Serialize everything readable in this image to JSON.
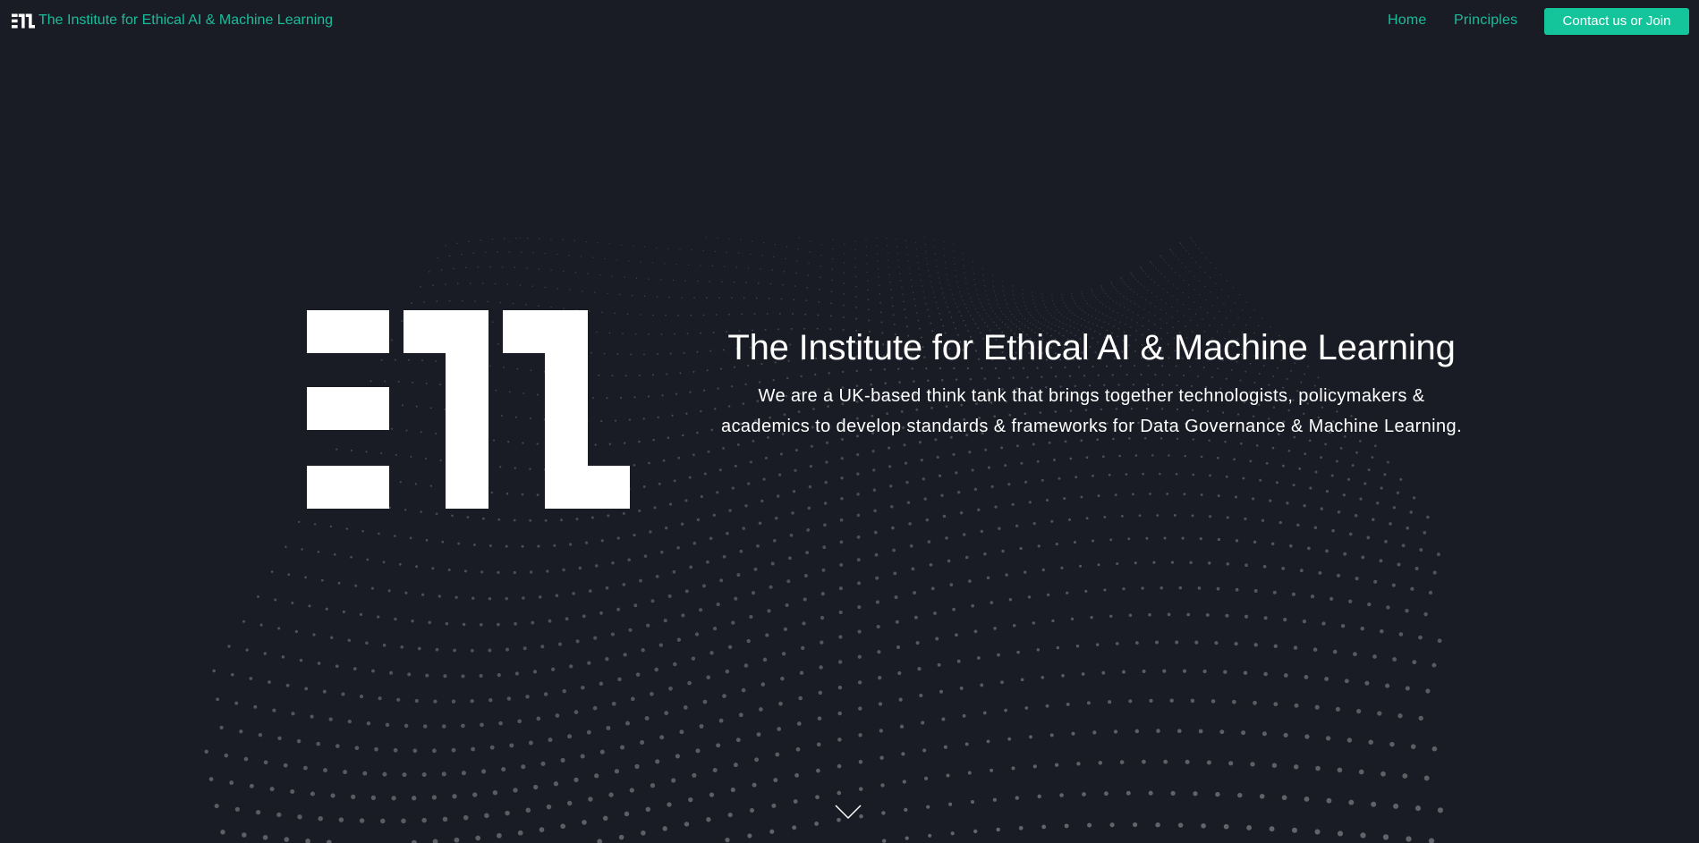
{
  "navbar": {
    "brand_logo_icon": "eiml-logo-icon",
    "brand_name": "The Institute for Ethical AI & Machine Learning",
    "links": [
      {
        "label": "Home"
      },
      {
        "label": "Principles"
      }
    ],
    "cta_label": "Contact us or Join"
  },
  "hero": {
    "logo_icon": "eiml-logo-icon",
    "title": "The Institute for Ethical AI & Machine Learning",
    "description_line1": "We are a UK-based think tank that brings together technologists, policymakers &",
    "description_line2": "academics to develop standards & frameworks for Data Governance & Machine Learning.",
    "background": "dot-wave-particles",
    "scroll_icon": "chevron-down-icon"
  },
  "colors": {
    "background": "#191c24",
    "accent": "#1bbc9b",
    "cta_background": "#14c49a",
    "text": "#ffffff",
    "particles": "#6b6e74"
  }
}
